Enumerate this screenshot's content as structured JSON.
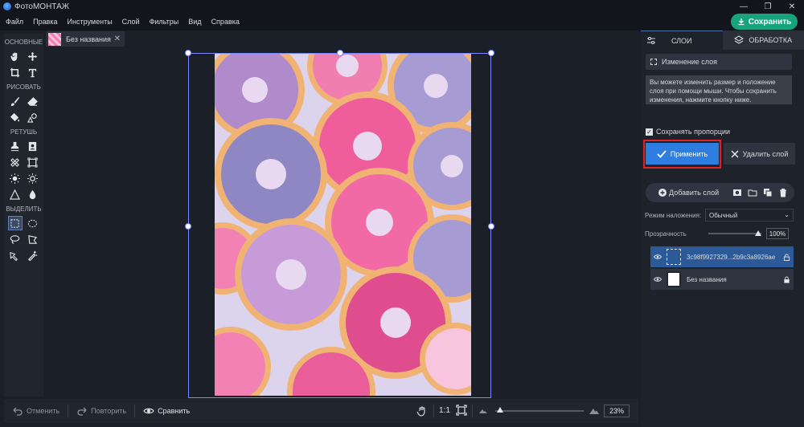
{
  "app": {
    "title": "ФотоМОНТАЖ"
  },
  "menu": [
    "Файл",
    "Правка",
    "Инструменты",
    "Слой",
    "Фильтры",
    "Вид",
    "Справка"
  ],
  "save_button": "Сохранить",
  "toolbar_sections": {
    "basic": "ОСНОВНЫЕ",
    "draw": "РИСОВАТЬ",
    "retouch": "РЕТУШЬ",
    "select": "ВЫДЕЛИТЬ"
  },
  "document_tab": {
    "name": "Без названия"
  },
  "bottom": {
    "undo": "Отменить",
    "redo": "Повторить",
    "compare": "Сравнить",
    "ratio": "1:1",
    "zoom": "23%",
    "zoom_fraction": 0.05
  },
  "right_panel": {
    "tabs": [
      "СЛОИ",
      "ОБРАБОТКА"
    ],
    "layer_change": "Изменение слоя",
    "info": "Вы можете изменить размер и положение слоя при помощи мыши. Чтобы сохранить изменения, нажмите кнопку ниже.",
    "keep_proportions": "Сохранять пропорции",
    "apply": "Применить",
    "delete_layer": "Удалить слой",
    "add_layer": "Добавить слой",
    "blend_label": "Режим наложения:",
    "blend_value": "Обычный",
    "opacity_label": "Прозрачность",
    "opacity_value": "100%",
    "layers": [
      {
        "name": "3c98f9927329...2b9c3a8926ae",
        "selected": true
      },
      {
        "name": "Без названия",
        "selected": false
      }
    ]
  },
  "colors": {
    "accent_green": "#17a37d",
    "apply_blue": "#2d7ee0",
    "highlight_red": "#e3202a",
    "layer_selected": "#2c5a98"
  }
}
